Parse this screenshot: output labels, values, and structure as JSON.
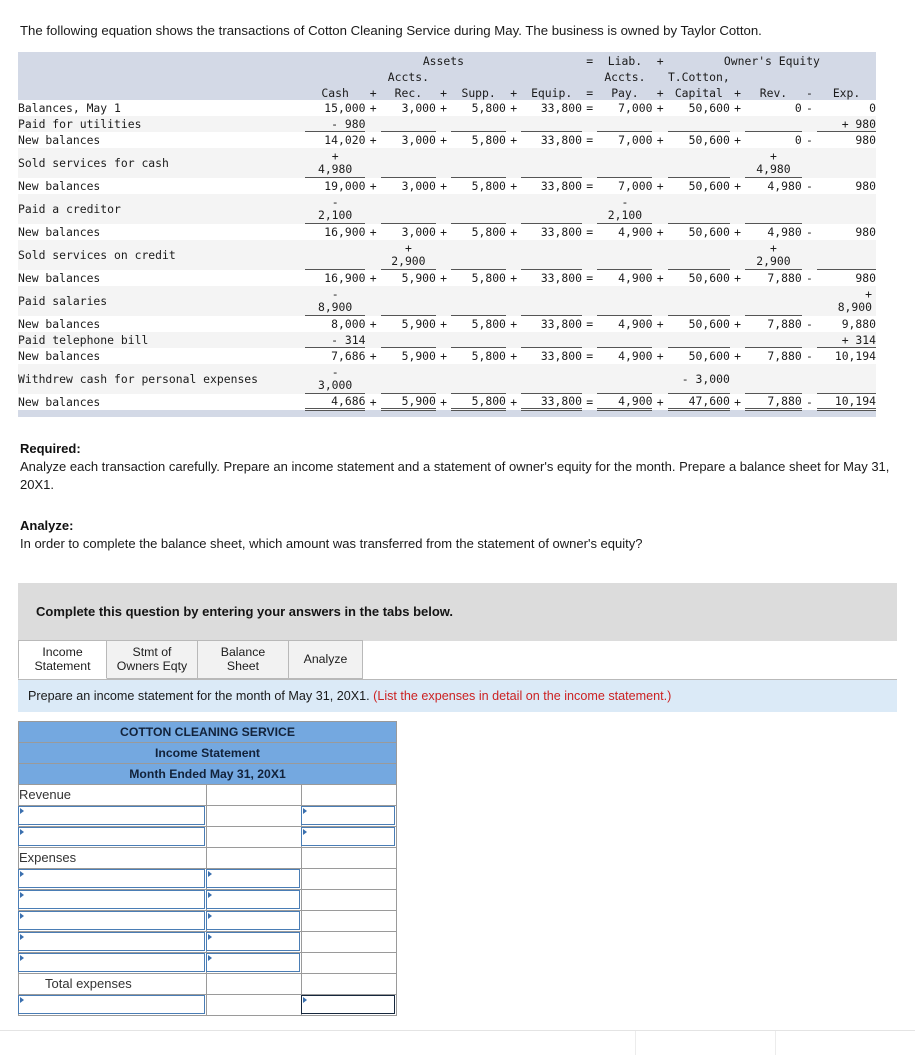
{
  "intro": "The following equation shows the transactions of Cotton Cleaning Service during May. The business is owned by Taylor Cotton.",
  "equation_table": {
    "group_headers": {
      "assets": "Assets",
      "eq1": "=",
      "liab": "Liab.",
      "plus1": "+",
      "owners_equity": "Owner's Equity"
    },
    "sub_headers": {
      "accts1": "Accts.",
      "accts2": "Accts.",
      "tcotton": "T.Cotton,"
    },
    "columns": {
      "cash": "Cash",
      "op1": "+",
      "rec": "Rec.",
      "op2": "+",
      "supp": "Supp.",
      "op3": "+",
      "equip": "Equip.",
      "op4": "=",
      "pay": "Pay.",
      "op5": "+",
      "capital": "Capital",
      "op6": "+",
      "rev": "Rev.",
      "op7": "-",
      "exp": "Exp."
    },
    "rows": [
      {
        "label": "Balances, May 1",
        "cash": "15,000",
        "rec": "3,000",
        "supp": "5,800",
        "equip": "33,800",
        "pay": "7,000",
        "capital": "50,600",
        "rev": "0",
        "exp": "0"
      },
      {
        "label": "Paid for utilities",
        "cash": "- 980",
        "rec": "",
        "supp": "",
        "equip": "",
        "pay": "",
        "capital": "",
        "rev": "",
        "exp": "+ 980"
      },
      {
        "label": "New balances",
        "cash": "14,020",
        "rec": "3,000",
        "supp": "5,800",
        "equip": "33,800",
        "pay": "7,000",
        "capital": "50,600",
        "rev": "0",
        "exp": "980"
      },
      {
        "label": "Sold services for cash",
        "cash_sign": "+",
        "cash": "4,980",
        "rec": "",
        "supp": "",
        "equip": "",
        "pay": "",
        "capital": "",
        "rev_sign": "+",
        "rev": "4,980",
        "exp": ""
      },
      {
        "label": "New balances",
        "cash": "19,000",
        "rec": "3,000",
        "supp": "5,800",
        "equip": "33,800",
        "pay": "7,000",
        "capital": "50,600",
        "rev": "4,980",
        "exp": "980"
      },
      {
        "label": "Paid a creditor",
        "cash_sign": "-",
        "cash": "2,100",
        "rec": "",
        "supp": "",
        "equip": "",
        "pay_sign": "-",
        "pay": "2,100",
        "capital": "",
        "rev": "",
        "exp": ""
      },
      {
        "label": "New balances",
        "cash": "16,900",
        "rec": "3,000",
        "supp": "5,800",
        "equip": "33,800",
        "pay": "4,900",
        "capital": "50,600",
        "rev": "4,980",
        "exp": "980"
      },
      {
        "label": "Sold services on credit",
        "cash": "",
        "rec_sign": "+",
        "rec": "2,900",
        "supp": "",
        "equip": "",
        "pay": "",
        "capital": "",
        "rev_sign": "+",
        "rev": "2,900",
        "exp": ""
      },
      {
        "label": "New balances",
        "cash": "16,900",
        "rec": "5,900",
        "supp": "5,800",
        "equip": "33,800",
        "pay": "4,900",
        "capital": "50,600",
        "rev": "7,880",
        "exp": "980"
      },
      {
        "label": "Paid salaries",
        "cash_sign": "-",
        "cash": "8,900",
        "rec": "",
        "supp": "",
        "equip": "",
        "pay": "",
        "capital": "",
        "rev": "",
        "exp_sign": "+",
        "exp": "8,900"
      },
      {
        "label": "New balances",
        "cash": "8,000",
        "rec": "5,900",
        "supp": "5,800",
        "equip": "33,800",
        "pay": "4,900",
        "capital": "50,600",
        "rev": "7,880",
        "exp": "9,880"
      },
      {
        "label": "Paid telephone bill",
        "cash": "- 314",
        "rec": "",
        "supp": "",
        "equip": "",
        "pay": "",
        "capital": "",
        "rev": "",
        "exp": "+ 314"
      },
      {
        "label": "New balances",
        "cash": "7,686",
        "rec": "5,900",
        "supp": "5,800",
        "equip": "33,800",
        "pay": "4,900",
        "capital": "50,600",
        "rev": "7,880",
        "exp": "10,194"
      },
      {
        "label": "Withdrew cash for personal expenses",
        "cash_sign": "-",
        "cash": "3,000",
        "rec": "",
        "supp": "",
        "equip": "",
        "pay": "",
        "capital": "- 3,000",
        "rev": "",
        "exp": ""
      },
      {
        "label": "New balances",
        "cash": "4,686",
        "rec": "5,900",
        "supp": "5,800",
        "equip": "33,800",
        "pay": "4,900",
        "capital": "47,600",
        "rev": "7,880",
        "exp": "10,194"
      }
    ]
  },
  "required": {
    "heading": "Required:",
    "body": "Analyze each transaction carefully. Prepare an income statement and a statement of owner's equity for the month. Prepare a balance sheet for May 31, 20X1."
  },
  "analyze": {
    "heading": "Analyze:",
    "body": "In order to complete the balance sheet, which amount was transferred from the statement of owner's equity?"
  },
  "instruction_box": "Complete this question by entering your answers in the tabs below.",
  "tabs": [
    {
      "label": "Income\nStatement",
      "line1": "Income",
      "line2": "Statement",
      "active": true
    },
    {
      "label": "Stmt of Owners Eqty",
      "line1": "Stmt of",
      "line2": "Owners Eqty",
      "active": false
    },
    {
      "label": "Balance Sheet",
      "line1": "Balance Sheet",
      "line2": "",
      "active": false
    },
    {
      "label": "Analyze",
      "line1": "Analyze",
      "line2": "",
      "active": false
    }
  ],
  "prompt": {
    "main": "Prepare an income statement for the month of May 31, 20X1. ",
    "hint": "(List the expenses in detail on the income statement.)"
  },
  "income_statement": {
    "title1": "COTTON CLEANING SERVICE",
    "title2": "Income Statement",
    "title3": "Month Ended May 31, 20X1",
    "revenue_label": "Revenue",
    "expenses_label": "Expenses",
    "total_expenses_label": "Total expenses",
    "revenue_input_rows": 2,
    "expense_input_rows": 5,
    "net_income_rows": 1,
    "input_values": []
  },
  "colors": {
    "header_band": "#d3d9e6",
    "statement_header_blue": "#74a8e0",
    "prompt_blue": "#dbeaf7",
    "instruction_gray": "#dcdcdc",
    "hint_red": "#cc2222",
    "input_border": "#4a7db5"
  }
}
